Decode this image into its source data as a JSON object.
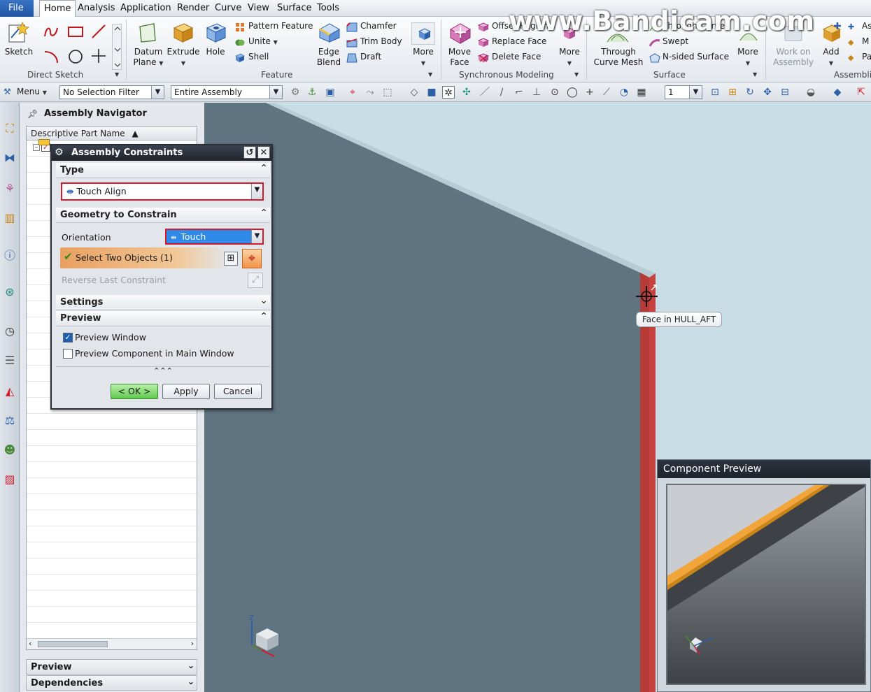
{
  "menu": {
    "file": "File",
    "items": [
      "Home",
      "Analysis",
      "Application",
      "Render",
      "Curve",
      "View",
      "Surface",
      "Tools"
    ]
  },
  "ribbon": {
    "sketch": "Sketch",
    "direct_sketch_group": "Direct Sketch",
    "datum_plane": "Datum Plane",
    "extrude": "Extrude",
    "hole": "Hole",
    "pattern_feature": "Pattern Feature",
    "unite": "Unite",
    "shell": "Shell",
    "edge_blend": "Edge Blend",
    "chamfer": "Chamfer",
    "trim_body": "Trim Body",
    "draft": "Draft",
    "more_feature": "More",
    "feature_group": "Feature",
    "move_face": "Move Face",
    "offset_region": "Offset Region",
    "replace_face": "Replace Face",
    "delete_face": "Delete Face",
    "more_sync": "More",
    "sync_group": "Synchronous Modeling",
    "through_curve_mesh": "Through Curve Mesh",
    "through_curves": "Through Curves",
    "swept": "Swept",
    "n_sided_surface": "N-sided Surface",
    "more_surface": "More",
    "surface_group": "Surface",
    "work_on_assembly": "Work on Assembly",
    "add": "Add",
    "assemblies_group": "Assembli",
    "cut_1": "As",
    "cut_2": "M",
    "cut_3": "Pa"
  },
  "toolbar": {
    "menu": "Menu",
    "selection_filter": "No Selection Filter",
    "scope": "Entire Assembly",
    "layer": "1"
  },
  "navigator": {
    "title": "Assembly Navigator",
    "column": "Descriptive Part Name",
    "footer_preview": "Preview",
    "footer_dependencies": "Dependencies"
  },
  "dialog": {
    "title": "Assembly Constraints",
    "type_section": "Type",
    "type_value": "Touch Align",
    "geometry_section": "Geometry to Constrain",
    "orientation_label": "Orientation",
    "orientation_value": "Touch",
    "select_objects": "Select Two Objects (1)",
    "reverse": "Reverse Last Constraint",
    "settings_section": "Settings",
    "preview_section": "Preview",
    "preview_window": "Preview Window",
    "preview_component": "Preview Component in Main Window",
    "ok": "< OK >",
    "apply": "Apply",
    "cancel": "Cancel"
  },
  "viewport": {
    "tooltip": "Face in HULL_AFT",
    "watermark": "www.Bandicam.com"
  },
  "component_preview": {
    "title": "Component Preview"
  },
  "colors": {
    "accent_red": "#d11c2e",
    "plate": "#5f7380",
    "edge_red": "#c8433f",
    "preview_orange": "#f2a53a"
  }
}
